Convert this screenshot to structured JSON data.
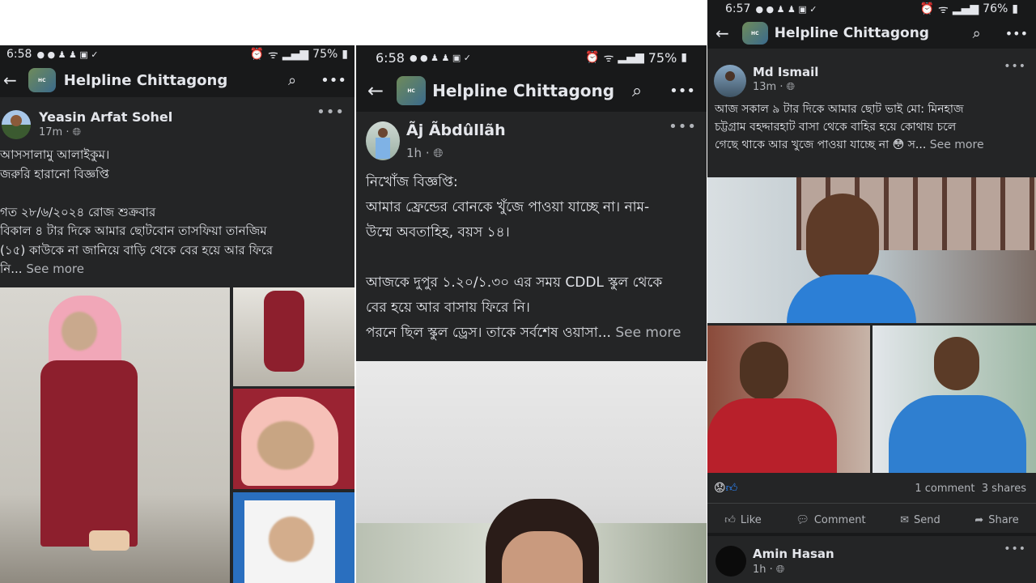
{
  "panel1": {
    "status": {
      "time": "6:58",
      "battery": "75%"
    },
    "group_title": "Helpline Chittagong",
    "post": {
      "author": "Yeasin Arfat Sohel",
      "time": "17m",
      "text": "আসসালামু আলাইকুম।\nজরুরি হারানো বিজ্ঞপ্তি\n\nগত ২৮/৬/২০২৪ রোজ শুক্রবার\nবিকাল ৪ টার দিকে আমার ছোটবোন তাসফিয়া তানজিম\n(১৫) কাউকে না জানিয়ে বাড়ি থেকে বের হয়ে আর ফিরে\nনি...",
      "see_more": "See more"
    }
  },
  "panel2": {
    "status": {
      "time": "6:58",
      "battery": "75%"
    },
    "group_title": "Helpline Chittagong",
    "post": {
      "author": "Ãj Ãbdûllãh",
      "time": "1h",
      "text": "নিখোঁজ বিজ্ঞপ্তি:\nআমার ফ্রেন্ডের বোনকে খুঁজে পাওয়া যাচ্ছে না। নাম-\nউম্মে অবতাহিহ, বয়স ১৪।\n\nআজকে দুপুর ১.২০/১.৩০ এর সময় CDDL স্কুল থেকে\nবের হয়ে আর বাসায় ফিরে নি।\nপরনে ছিল স্কুল ড্রেস। তাকে সর্বশেষ ওয়াসা...",
      "see_more": "See more"
    }
  },
  "panel3": {
    "status": {
      "time": "6:57",
      "battery": "76%"
    },
    "group_title": "Helpline Chittagong",
    "post": {
      "author": "Md Ismail",
      "time": "13m",
      "text": "আজ সকাল ৯ টার দিকে আমার ছোট ভাই মো: মিনহাজ\nচট্টগ্রাম বহদ্দারহাট  বাসা থেকে বাহির হয়ে কোথায় চলে\nগেছে থাকে আর খুজে পাওয়া যাচ্ছে না 😳 স...",
      "see_more": "See more",
      "comments": "1 comment",
      "shares": "3 shares",
      "actions": {
        "like": "Like",
        "comment": "Comment",
        "send": "Send",
        "share": "Share"
      }
    },
    "next_post": {
      "author": "Amin Hasan",
      "time": "1h"
    }
  },
  "icons": [
    "back-arrow-icon",
    "search-icon",
    "more-options-icon",
    "globe-icon",
    "like-icon",
    "comment-icon",
    "messenger-icon",
    "share-icon"
  ]
}
